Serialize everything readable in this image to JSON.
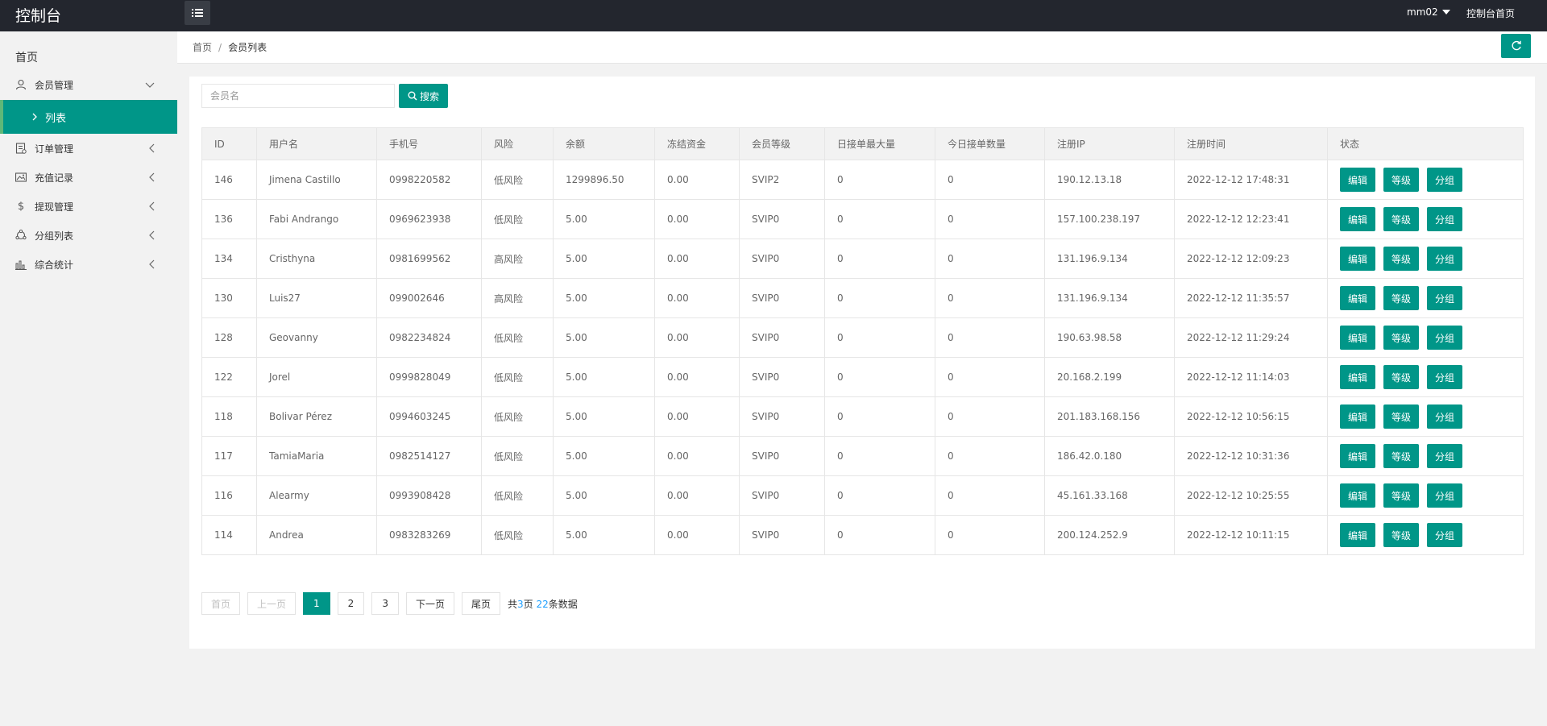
{
  "app": {
    "title": "控制台",
    "username": "mm02",
    "home_link": "控制台首页"
  },
  "sidebar": {
    "home": "首页",
    "items": [
      {
        "label": "会员管理",
        "icon": "user-icon"
      },
      {
        "label": "列表",
        "icon": "chevron-right-icon"
      },
      {
        "label": "订单管理",
        "icon": "order-icon"
      },
      {
        "label": "充值记录",
        "icon": "image-icon"
      },
      {
        "label": "提现管理",
        "icon": "dollar-icon"
      },
      {
        "label": "分组列表",
        "icon": "group-icon"
      },
      {
        "label": "综合统计",
        "icon": "chart-icon"
      }
    ]
  },
  "breadcrumb": {
    "home": "首页",
    "separator": "/",
    "current": "会员列表"
  },
  "search": {
    "placeholder": "会员名",
    "button_label": "搜索"
  },
  "table": {
    "columns": [
      "ID",
      "用户名",
      "手机号",
      "风险",
      "余额",
      "冻结资金",
      "会员等级",
      "日接单最大量",
      "今日接单数量",
      "注册IP",
      "注册时间",
      "状态"
    ],
    "action_labels": {
      "edit": "编辑",
      "level": "等级",
      "group": "分组"
    },
    "rows": [
      {
        "id": "146",
        "username": "Jimena Castillo",
        "phone": "0998220582",
        "risk": "低风险",
        "risk_level": "low",
        "balance": "1299896.50",
        "frozen": "0.00",
        "vip": "SVIP2",
        "daily_max": "0",
        "today_count": "0",
        "ip": "190.12.13.18",
        "reg_time": "2022-12-12 17:48:31"
      },
      {
        "id": "136",
        "username": "Fabi Andrango",
        "phone": "0969623938",
        "risk": "低风险",
        "risk_level": "low",
        "balance": "5.00",
        "frozen": "0.00",
        "vip": "SVIP0",
        "daily_max": "0",
        "today_count": "0",
        "ip": "157.100.238.197",
        "reg_time": "2022-12-12 12:23:41"
      },
      {
        "id": "134",
        "username": "Cristhyna",
        "phone": "0981699562",
        "risk": "高风险",
        "risk_level": "high",
        "balance": "5.00",
        "frozen": "0.00",
        "vip": "SVIP0",
        "daily_max": "0",
        "today_count": "0",
        "ip": "131.196.9.134",
        "reg_time": "2022-12-12 12:09:23"
      },
      {
        "id": "130",
        "username": "Luis27",
        "phone": "099002646",
        "risk": "高风险",
        "risk_level": "high",
        "balance": "5.00",
        "frozen": "0.00",
        "vip": "SVIP0",
        "daily_max": "0",
        "today_count": "0",
        "ip": "131.196.9.134",
        "reg_time": "2022-12-12 11:35:57"
      },
      {
        "id": "128",
        "username": "Geovanny",
        "phone": "0982234824",
        "risk": "低风险",
        "risk_level": "low",
        "balance": "5.00",
        "frozen": "0.00",
        "vip": "SVIP0",
        "daily_max": "0",
        "today_count": "0",
        "ip": "190.63.98.58",
        "reg_time": "2022-12-12 11:29:24"
      },
      {
        "id": "122",
        "username": "Jorel",
        "phone": "0999828049",
        "risk": "低风险",
        "risk_level": "low",
        "balance": "5.00",
        "frozen": "0.00",
        "vip": "SVIP0",
        "daily_max": "0",
        "today_count": "0",
        "ip": "20.168.2.199",
        "reg_time": "2022-12-12 11:14:03"
      },
      {
        "id": "118",
        "username": "Bolivar Pérez",
        "phone": "0994603245",
        "risk": "低风险",
        "risk_level": "low",
        "balance": "5.00",
        "frozen": "0.00",
        "vip": "SVIP0",
        "daily_max": "0",
        "today_count": "0",
        "ip": "201.183.168.156",
        "reg_time": "2022-12-12 10:56:15"
      },
      {
        "id": "117",
        "username": "TamiaMaria",
        "phone": "0982514127",
        "risk": "低风险",
        "risk_level": "low",
        "balance": "5.00",
        "frozen": "0.00",
        "vip": "SVIP0",
        "daily_max": "0",
        "today_count": "0",
        "ip": "186.42.0.180",
        "reg_time": "2022-12-12 10:31:36"
      },
      {
        "id": "116",
        "username": "Alearmy",
        "phone": "0993908428",
        "risk": "低风险",
        "risk_level": "low",
        "balance": "5.00",
        "frozen": "0.00",
        "vip": "SVIP0",
        "daily_max": "0",
        "today_count": "0",
        "ip": "45.161.33.168",
        "reg_time": "2022-12-12 10:25:55"
      },
      {
        "id": "114",
        "username": "Andrea",
        "phone": "0983283269",
        "risk": "低风险",
        "risk_level": "low",
        "balance": "5.00",
        "frozen": "0.00",
        "vip": "SVIP0",
        "daily_max": "0",
        "today_count": "0",
        "ip": "200.124.252.9",
        "reg_time": "2022-12-12 10:11:15"
      }
    ]
  },
  "pagination": {
    "first": "首页",
    "prev": "上一页",
    "pages": [
      "1",
      "2",
      "3"
    ],
    "current_page": "1",
    "next": "下一页",
    "last": "尾页",
    "info_prefix": "共",
    "total_pages": "3",
    "info_mid": "页",
    "total_records": "22",
    "info_suffix": "条数据"
  },
  "colors": {
    "accent": "#009688",
    "topbar": "#23262e",
    "risk_low": "#0a8a00",
    "risk_high": "#ff0000",
    "link": "#1e9fff"
  }
}
